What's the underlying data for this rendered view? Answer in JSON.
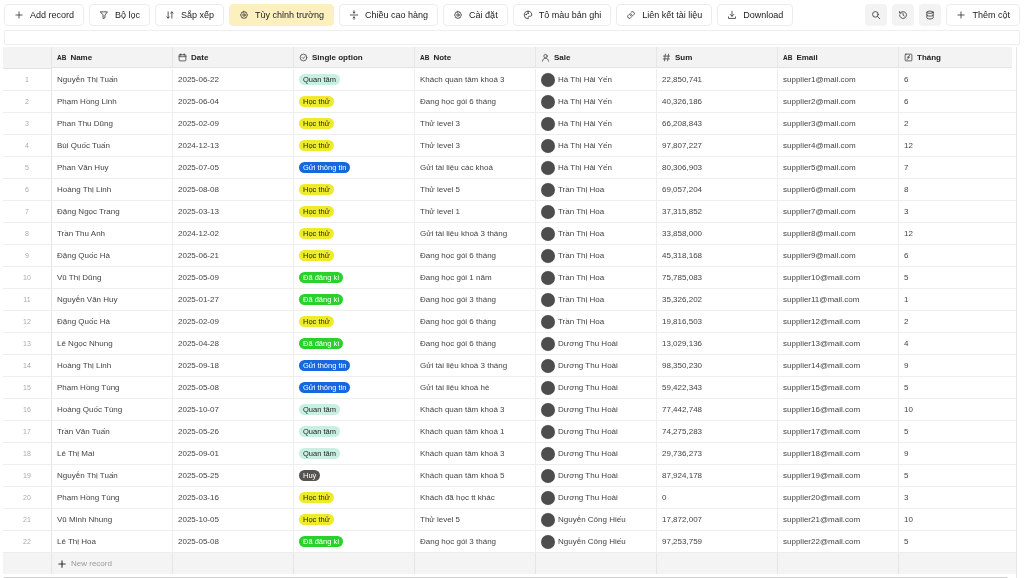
{
  "toolbar": {
    "buttons": [
      {
        "label": "Add record",
        "selected": false
      },
      {
        "label": "Bộ lọc",
        "selected": false
      },
      {
        "label": "Sắp xếp",
        "selected": false
      },
      {
        "label": "Tùy chỉnh trường",
        "selected": true
      },
      {
        "label": "Chiều cao hàng",
        "selected": false
      },
      {
        "label": "Cài đặt",
        "selected": false
      },
      {
        "label": "Tô màu bản ghi",
        "selected": false
      },
      {
        "label": "Liên kết tài liệu",
        "selected": false
      },
      {
        "label": "Download",
        "selected": false
      }
    ],
    "add_column": "Thêm cột"
  },
  "table": {
    "columns": [
      {
        "kind": "text",
        "type_mark": "AB",
        "label": "Name"
      },
      {
        "kind": "date",
        "label": "Date"
      },
      {
        "kind": "option",
        "label": "Single option"
      },
      {
        "kind": "text",
        "type_mark": "AB",
        "label": "Note"
      },
      {
        "kind": "person",
        "label": "Sale"
      },
      {
        "kind": "number",
        "label": "Sum"
      },
      {
        "kind": "text",
        "type_mark": "AB",
        "label": "Email"
      },
      {
        "kind": "formula",
        "label": "Tháng"
      }
    ],
    "rows": [
      {
        "index": "1",
        "name": "Nguyễn Thị Tuấn",
        "date": "2025-06-22",
        "option": {
          "label": "Quan tâm",
          "color": "#c9eee2"
        },
        "note": "Khách quan tâm khoá 3",
        "sale": "Hà Thị Hải Yến",
        "sum": "22,850,741",
        "email": "supplier1@mail.com",
        "month": "6"
      },
      {
        "index": "2",
        "name": "Phạm Hồng Linh",
        "date": "2025-06-04",
        "option": {
          "label": "Học thử",
          "color": "#eeea2c"
        },
        "note": "Đang học gói 6 tháng",
        "sale": "Hà Thị Hải Yến",
        "sum": "40,326,186",
        "email": "supplier2@mail.com",
        "month": "6"
      },
      {
        "index": "3",
        "name": "Phan Thu Dũng",
        "date": "2025-02-09",
        "option": {
          "label": "Học thử",
          "color": "#eeea2c"
        },
        "note": "Thử level 3",
        "sale": "Hà Thị Hải Yến",
        "sum": "66,208,843",
        "email": "supplier3@mail.com",
        "month": "2"
      },
      {
        "index": "4",
        "name": "Bùi Quốc Tuấn",
        "date": "2024-12-13",
        "option": {
          "label": "Học thử",
          "color": "#eeea2c"
        },
        "note": "Thử level 3",
        "sale": "Hà Thị Hải Yến",
        "sum": "97,807,227",
        "email": "supplier4@mail.com",
        "month": "12"
      },
      {
        "index": "5",
        "name": "Phan Văn Huy",
        "date": "2025-07-05",
        "option": {
          "label": "Gửi thông tin",
          "color": "#1668dc"
        },
        "note": "Gửi tài liệu các khoá",
        "sale": "Hà Thị Hải Yến",
        "sum": "80,306,903",
        "email": "supplier5@mail.com",
        "month": "7"
      },
      {
        "index": "6",
        "name": "Hoàng Thị Linh",
        "date": "2025-08-08",
        "option": {
          "label": "Học thử",
          "color": "#eeea2c"
        },
        "note": "Thử level 5",
        "sale": "Trần Thị Hoa",
        "sum": "69,057,204",
        "email": "supplier6@mail.com",
        "month": "8"
      },
      {
        "index": "7",
        "name": "Đặng Ngọc Trang",
        "date": "2025-03-13",
        "option": {
          "label": "Học thử",
          "color": "#eeea2c"
        },
        "note": "Thử level 1",
        "sale": "Trần Thị Hoa",
        "sum": "37,315,852",
        "email": "supplier7@mail.com",
        "month": "3"
      },
      {
        "index": "8",
        "name": "Trần Thu Anh",
        "date": "2024-12-02",
        "option": {
          "label": "Học thử",
          "color": "#eeea2c"
        },
        "note": "Gửi tài liệu khoá 3 tháng",
        "sale": "Trần Thị Hoa",
        "sum": "33,858,000",
        "email": "supplier8@mail.com",
        "month": "12"
      },
      {
        "index": "9",
        "name": "Đặng Quốc Hà",
        "date": "2025-06-21",
        "option": {
          "label": "Học thử",
          "color": "#eeea2c"
        },
        "note": "Đang học gói 6 tháng",
        "sale": "Trần Thị Hoa",
        "sum": "45,318,168",
        "email": "supplier9@mail.com",
        "month": "6"
      },
      {
        "index": "10",
        "name": "Vũ Thị Dũng",
        "date": "2025-05-09",
        "option": {
          "label": "Đã đăng kí",
          "color": "#2ad12a"
        },
        "note": "Đang học gói 1 năm",
        "sale": "Trần Thị Hoa",
        "sum": "75,785,083",
        "email": "supplier10@mail.com",
        "month": "5"
      },
      {
        "index": "11",
        "name": "Nguyễn Văn Huy",
        "date": "2025-01-27",
        "option": {
          "label": "Đã đăng kí",
          "color": "#2ad12a"
        },
        "note": "Đang học gói 3 tháng",
        "sale": "Trần Thị Hoa",
        "sum": "35,326,202",
        "email": "supplier11@mail.com",
        "month": "1"
      },
      {
        "index": "12",
        "name": "Đặng Quốc Hà",
        "date": "2025-02-09",
        "option": {
          "label": "Học thử",
          "color": "#eeea2c"
        },
        "note": "Đang học gói 6 tháng",
        "sale": "Trần Thị Hoa",
        "sum": "19,816,503",
        "email": "supplier12@mail.com",
        "month": "2"
      },
      {
        "index": "13",
        "name": "Lê Ngọc Nhung",
        "date": "2025-04-28",
        "option": {
          "label": "Đã đăng kí",
          "color": "#2ad12a"
        },
        "note": "Đang học gói 6 tháng",
        "sale": "Dương Thu Hoài",
        "sum": "13,029,136",
        "email": "supplier13@mail.com",
        "month": "4"
      },
      {
        "index": "14",
        "name": "Hoàng Thị Linh",
        "date": "2025-09-18",
        "option": {
          "label": "Gửi thông tin",
          "color": "#1668dc"
        },
        "note": "Gửi tài liệu khoá 3 tháng",
        "sale": "Dương Thu Hoài",
        "sum": "98,350,230",
        "email": "supplier14@mail.com",
        "month": "9"
      },
      {
        "index": "15",
        "name": "Phạm Hồng Tùng",
        "date": "2025-05-08",
        "option": {
          "label": "Gửi thông tin",
          "color": "#1668dc"
        },
        "note": "Gửi tài liệu khoá hè",
        "sale": "Dương Thu Hoài",
        "sum": "59,422,343",
        "email": "supplier15@mail.com",
        "month": "5"
      },
      {
        "index": "16",
        "name": "Hoàng Quốc Tùng",
        "date": "2025-10-07",
        "option": {
          "label": "Quan tâm",
          "color": "#c9eee2"
        },
        "note": "Khách quan tâm khoá 3",
        "sale": "Dương Thu Hoài",
        "sum": "77,442,748",
        "email": "supplier16@mail.com",
        "month": "10"
      },
      {
        "index": "17",
        "name": "Trần Văn Tuấn",
        "date": "2025-05-26",
        "option": {
          "label": "Quan tâm",
          "color": "#c9eee2"
        },
        "note": "Khách quan tâm khoá 1",
        "sale": "Dương Thu Hoài",
        "sum": "74,275,283",
        "email": "supplier17@mail.com",
        "month": "5"
      },
      {
        "index": "18",
        "name": "Lê Thị Mai",
        "date": "2025-09-01",
        "option": {
          "label": "Quan tâm",
          "color": "#c9eee2"
        },
        "note": "Khách quan tâm khoá 3",
        "sale": "Dương Thu Hoài",
        "sum": "29,736,273",
        "email": "supplier18@mail.com",
        "month": "9"
      },
      {
        "index": "19",
        "name": "Nguyễn Thị Tuấn",
        "date": "2025-05-25",
        "option": {
          "label": "Huỷ",
          "color": "#555452"
        },
        "note": "Khách quan tâm khoá 5",
        "sale": "Dương Thu Hoài",
        "sum": "87,924,178",
        "email": "supplier19@mail.com",
        "month": "5"
      },
      {
        "index": "20",
        "name": "Phạm Hồng Tùng",
        "date": "2025-03-16",
        "option": {
          "label": "Học thử",
          "color": "#eeea2c"
        },
        "note": "Khách đã học tt khác",
        "sale": "Dương Thu Hoài",
        "sum": "0",
        "email": "supplier20@mail.com",
        "month": "3"
      },
      {
        "index": "21",
        "name": "Vũ Minh Nhung",
        "date": "2025-10-05",
        "option": {
          "label": "Học thử",
          "color": "#eeea2c"
        },
        "note": "Thử level 5",
        "sale": "Nguyễn Công Hiếu",
        "sum": "17,872,007",
        "email": "supplier21@mail.com",
        "month": "10"
      },
      {
        "index": "22",
        "name": "Lê Thị Hoa",
        "date": "2025-05-08",
        "option": {
          "label": "Đã đăng kí",
          "color": "#2ad12a"
        },
        "note": "Đang học gói 3 tháng",
        "sale": "Nguyễn Công Hiếu",
        "sum": "97,253,759",
        "email": "supplier22@mail.com",
        "month": "5"
      }
    ],
    "new_record": "New record"
  }
}
